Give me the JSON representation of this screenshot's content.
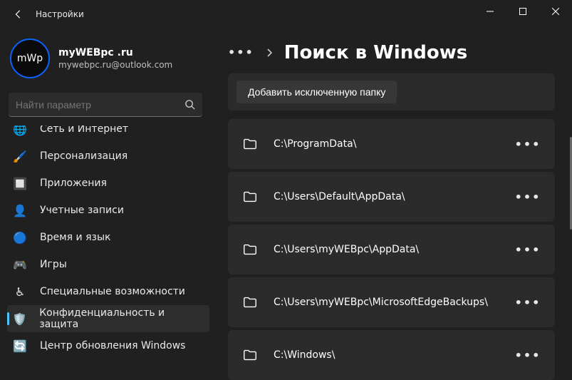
{
  "window": {
    "title": "Настройки"
  },
  "profile": {
    "name": "myWEBpc .ru",
    "email": "mywebpc.ru@outlook.com",
    "avatar_text": "mWp"
  },
  "search": {
    "placeholder": "Найти параметр"
  },
  "sidebar": {
    "items": [
      {
        "label": "Сеть и Интернет",
        "icon": "🌐"
      },
      {
        "label": "Персонализация",
        "icon": "🖌️"
      },
      {
        "label": "Приложения",
        "icon": "🔲"
      },
      {
        "label": "Учетные записи",
        "icon": "👤"
      },
      {
        "label": "Время и язык",
        "icon": "🔵"
      },
      {
        "label": "Игры",
        "icon": "🎮"
      },
      {
        "label": "Специальные возможности",
        "icon": "♿"
      },
      {
        "label": "Конфиденциальность и защита",
        "icon": "🛡️",
        "selected": true
      },
      {
        "label": "Центр обновления Windows",
        "icon": "🔄"
      }
    ]
  },
  "main": {
    "page_title": "Поиск в Windows",
    "add_button": "Добавить исключенную папку",
    "folders": [
      {
        "path": "C:\\ProgramData\\"
      },
      {
        "path": "C:\\Users\\Default\\AppData\\"
      },
      {
        "path": "C:\\Users\\myWEBpc\\AppData\\"
      },
      {
        "path": "C:\\Users\\myWEBpc\\MicrosoftEdgeBackups\\"
      },
      {
        "path": "C:\\Windows\\"
      }
    ]
  }
}
